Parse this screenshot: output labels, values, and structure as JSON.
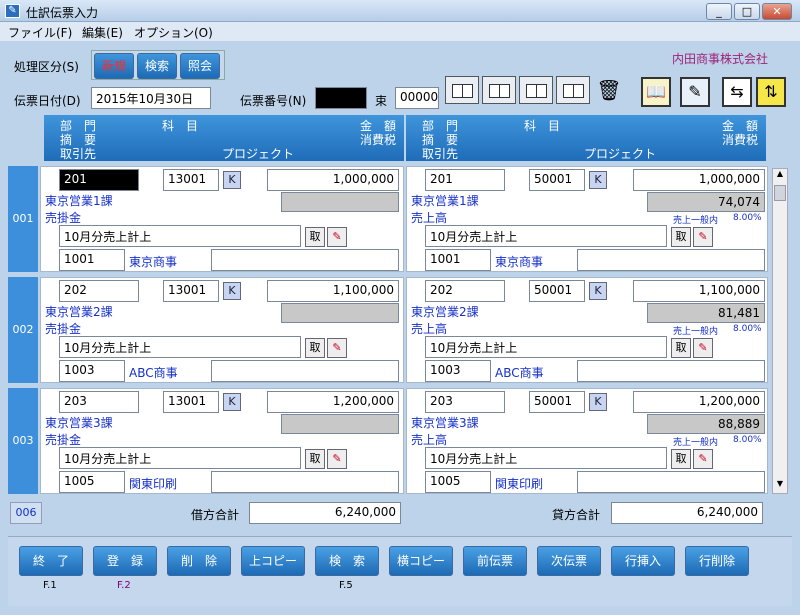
{
  "window": {
    "title": "仕訳伝票入力",
    "app_icon": "journal-app-icon",
    "minimize": "_",
    "maximize": "□",
    "close": "✕"
  },
  "menu": [
    "ファイル(F)",
    "編集(E)",
    "オプション(O)"
  ],
  "company": "内田商事株式会社",
  "toolbar": {
    "mode_label": "処理区分(S)",
    "new": "新規",
    "search": "検索",
    "inquiry": "照会",
    "date_label": "伝票日付(D)",
    "date_value": "2015年10月30日",
    "number_label": "伝票番号(N)",
    "number_value": "",
    "bundle_label": "束",
    "bundle_value": "00000"
  },
  "header": {
    "dept": "部　門",
    "account": "科　目",
    "amount": "金　額",
    "summary": "摘　要",
    "tax": "消費税",
    "partner": "取引先",
    "project": "プロジェクト"
  },
  "rows": [
    {
      "num": "001",
      "debit": {
        "dept": "201",
        "account": "13001",
        "amount": "1,000,000",
        "dept_name": "東京営業1課",
        "account_name": "売掛金",
        "tax": "",
        "summary": "10月分売上計上",
        "partner_code": "1001",
        "partner_name": "東京商事",
        "project": ""
      },
      "credit": {
        "dept": "201",
        "account": "50001",
        "amount": "1,000,000",
        "dept_name": "東京営業1課",
        "account_name": "売上高",
        "tax": "74,074",
        "tax_type": "売上一般内",
        "tax_rate": "8.00%",
        "summary": "10月分売上計上",
        "partner_code": "1001",
        "partner_name": "東京商事",
        "project": ""
      }
    },
    {
      "num": "002",
      "debit": {
        "dept": "202",
        "account": "13001",
        "amount": "1,100,000",
        "dept_name": "東京営業2課",
        "account_name": "売掛金",
        "tax": "",
        "summary": "10月分売上計上",
        "partner_code": "1003",
        "partner_name": "ABC商事",
        "project": ""
      },
      "credit": {
        "dept": "202",
        "account": "50001",
        "amount": "1,100,000",
        "dept_name": "東京営業2課",
        "account_name": "売上高",
        "tax": "81,481",
        "tax_type": "売上一般内",
        "tax_rate": "8.00%",
        "summary": "10月分売上計上",
        "partner_code": "1003",
        "partner_name": "ABC商事",
        "project": ""
      }
    },
    {
      "num": "003",
      "debit": {
        "dept": "203",
        "account": "13001",
        "amount": "1,200,000",
        "dept_name": "東京営業3課",
        "account_name": "売掛金",
        "tax": "",
        "summary": "10月分売上計上",
        "partner_code": "1005",
        "partner_name": "関東印刷",
        "project": ""
      },
      "credit": {
        "dept": "203",
        "account": "50001",
        "amount": "1,200,000",
        "dept_name": "東京営業3課",
        "account_name": "売上高",
        "tax": "88,889",
        "tax_type": "売上一般内",
        "tax_rate": "8.00%",
        "summary": "10月分売上計上",
        "partner_code": "1005",
        "partner_name": "関東印刷",
        "project": ""
      }
    }
  ],
  "k_label": "K",
  "tori_label": "取",
  "pen_icon": "✎",
  "totals": {
    "row_count": "006",
    "debit_label": "借方合計",
    "debit_value": "6,240,000",
    "credit_label": "貸方合計",
    "credit_value": "6,240,000"
  },
  "fkeys": [
    {
      "label": "終　了",
      "key": "F.1"
    },
    {
      "label": "登　録",
      "key": "F.2"
    },
    {
      "label": "削　除",
      "key": ""
    },
    {
      "label": "上コピー",
      "key": ""
    },
    {
      "label": "検　索",
      "key": "F.5"
    },
    {
      "label": "横コピー",
      "key": ""
    },
    {
      "label": "前伝票",
      "key": ""
    },
    {
      "label": "次伝票",
      "key": ""
    },
    {
      "label": "行挿入",
      "key": ""
    },
    {
      "label": "行削除",
      "key": ""
    }
  ],
  "colors": {
    "accent": "#1f6cb8",
    "background": "#bcd3ea",
    "label_blue": "#1530c8",
    "fkey2_color": "#800080"
  }
}
